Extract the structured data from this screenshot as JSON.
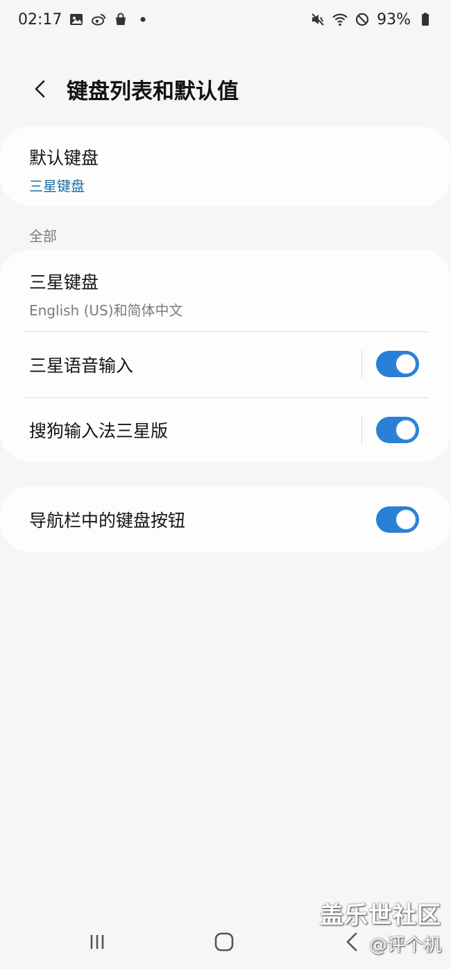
{
  "status_bar": {
    "time": "02:17",
    "battery": "93%",
    "left_icons": [
      "gallery-icon",
      "weibo-icon",
      "shopping-bag-icon",
      "dot-icon"
    ],
    "right_icons": [
      "mute-vibrate-icon",
      "wifi-icon",
      "do-not-disturb-icon",
      "battery-icon"
    ]
  },
  "header": {
    "title": "键盘列表和默认值",
    "back_icon": "chevron-left-icon"
  },
  "default_keyboard": {
    "title": "默认键盘",
    "value": "三星键盘"
  },
  "section": {
    "all_label": "全部"
  },
  "keyboards": [
    {
      "title": "三星键盘",
      "subtitle": "English (US)和简体中文"
    },
    {
      "title": "三星语音输入",
      "enabled": true
    },
    {
      "title": "搜狗输入法三星版",
      "enabled": true
    }
  ],
  "nav_keyboard_button": {
    "title": "导航栏中的键盘按钮",
    "enabled": true
  },
  "colors": {
    "accent": "#2a7fd6",
    "link_blue": "#1a6ea8",
    "background": "#f6f6f6",
    "card": "#fdfdfd"
  },
  "navigation": {
    "icons": [
      "recents-icon",
      "home-icon",
      "back-icon"
    ]
  },
  "watermark": {
    "line1": "盖乐世社区",
    "line2": "@评个机"
  }
}
